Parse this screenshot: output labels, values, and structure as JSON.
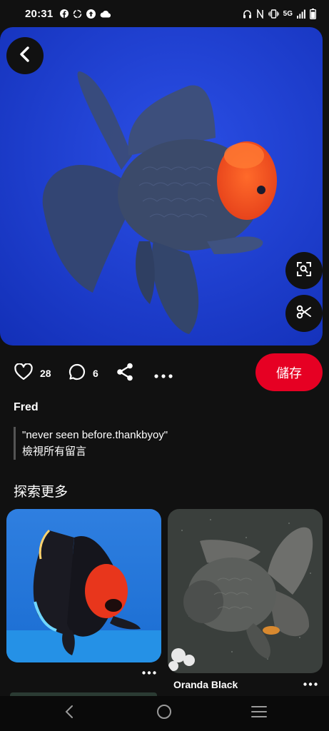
{
  "status": {
    "time": "20:31",
    "network": "5G",
    "left_icons": [
      "facebook-icon",
      "sync-icon",
      "upload-icon",
      "cloud-icon"
    ],
    "right_icons": [
      "headphones-icon",
      "nfc-icon",
      "vibrate-icon",
      "signal-icon",
      "battery-icon"
    ]
  },
  "pin": {
    "like_count": "28",
    "comment_count": "6",
    "save_label": "儲存"
  },
  "comment": {
    "author": "Fred",
    "text": "\"never seen before.thankbyoy\"",
    "view_all": "檢視所有留言"
  },
  "explore": {
    "title": "探索更多",
    "cards": [
      {
        "title": ""
      },
      {
        "title": "Oranda Black"
      }
    ]
  },
  "colors": {
    "background": "#111111",
    "save_button": "#e60023",
    "hero_bg": "#1c3bd6"
  }
}
